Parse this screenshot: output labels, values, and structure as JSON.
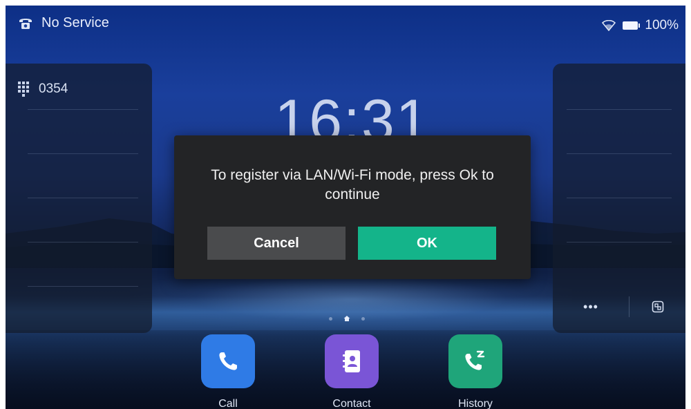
{
  "status_bar": {
    "service_text": "No Service",
    "battery_text": "100%",
    "icons": [
      "phone-handset-icon",
      "wifi-icon",
      "battery-icon"
    ]
  },
  "left_panel": {
    "account_number": "0354",
    "icon": "dialpad-icon"
  },
  "right_panel": {
    "more_label": "•••",
    "icons": [
      "more-icon",
      "switch-screen-icon"
    ]
  },
  "clock": {
    "time": "16:31"
  },
  "dialog": {
    "message": "To register via LAN/Wi-Fi mode, press Ok to continue",
    "cancel_label": "Cancel",
    "ok_label": "OK"
  },
  "dock": {
    "items": [
      {
        "label": "Call",
        "icon": "phone-icon",
        "color": "#2f7be6"
      },
      {
        "label": "Contact",
        "icon": "contact-book-icon",
        "color": "#7a55d6"
      },
      {
        "label": "History",
        "icon": "call-history-icon",
        "color": "#1fa57a"
      }
    ]
  },
  "colors": {
    "accent": "#14b48a",
    "dialog_bg": "#232426",
    "cancel_bg": "#4a4b4d"
  }
}
